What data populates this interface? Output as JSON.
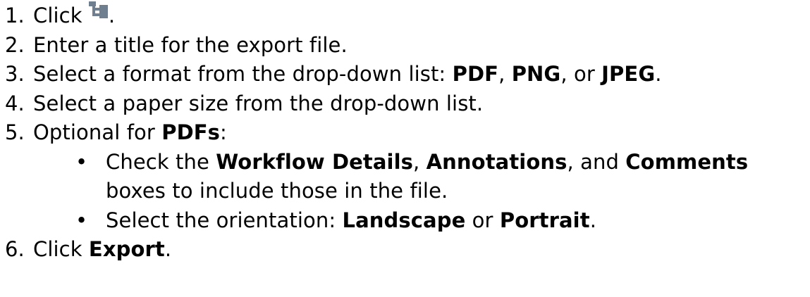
{
  "steps": [
    {
      "number": "1.",
      "text_before": "Click ",
      "icon": "workflow-tree-icon",
      "text_after": "."
    },
    {
      "number": "2.",
      "text": "Enter a title for the export file."
    },
    {
      "number": "3.",
      "text_before": "Select a format from the drop-down list: ",
      "format_pdf": "PDF",
      "sep1": ", ",
      "format_png": "PNG",
      "sep2": ", or ",
      "format_jpeg": "JPEG",
      "text_after": "."
    },
    {
      "number": "4.",
      "text": "Select a paper size from the drop-down list."
    },
    {
      "number": "5.",
      "text_before": "Optional for ",
      "pdfs": "PDFs",
      "text_after": ":",
      "sub": [
        {
          "bullet": "•",
          "text_before": "Check the ",
          "workflow_details": "Workflow Details",
          "sep1": ", ",
          "annotations": "Annotations",
          "sep2": ", and ",
          "comments": "Comments",
          "line2": "boxes to include those in the file."
        },
        {
          "bullet": "•",
          "text_before": "Select the orientation: ",
          "landscape": "Landscape",
          "sep": " or ",
          "portrait": "Portrait",
          "text_after": "."
        }
      ]
    },
    {
      "number": "6.",
      "text_before": "Click ",
      "export": "Export",
      "text_after": "."
    }
  ],
  "colors": {
    "text": "#000000",
    "icon": "#6f7f8f"
  }
}
